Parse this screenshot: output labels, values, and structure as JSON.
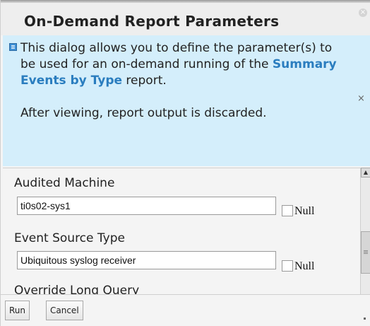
{
  "dialog": {
    "title": "On-Demand Report Parameters"
  },
  "info": {
    "text_before": "This dialog allows you to define the parameter(s) to be used for an on-demand running of the ",
    "report_name": "Summary Events by Type",
    "text_after": " report.",
    "note": "After viewing, report output is discarded.",
    "icon": "info-icon",
    "dismiss_glyph": "×"
  },
  "fields": [
    {
      "label": "Audited Machine",
      "value": "ti0s02-sys1",
      "null_label": "Null",
      "null_checked": false
    },
    {
      "label": "Event Source Type",
      "value": "Ubiquitous syslog receiver",
      "null_label": "Null",
      "null_checked": false
    },
    {
      "label": "Override Long Query"
    }
  ],
  "buttons": {
    "run": "Run",
    "cancel": "Cancel"
  },
  "colors": {
    "info_background": "#d4eefb",
    "link": "#2a7dbf",
    "dialog_background": "#f4f4f4"
  }
}
